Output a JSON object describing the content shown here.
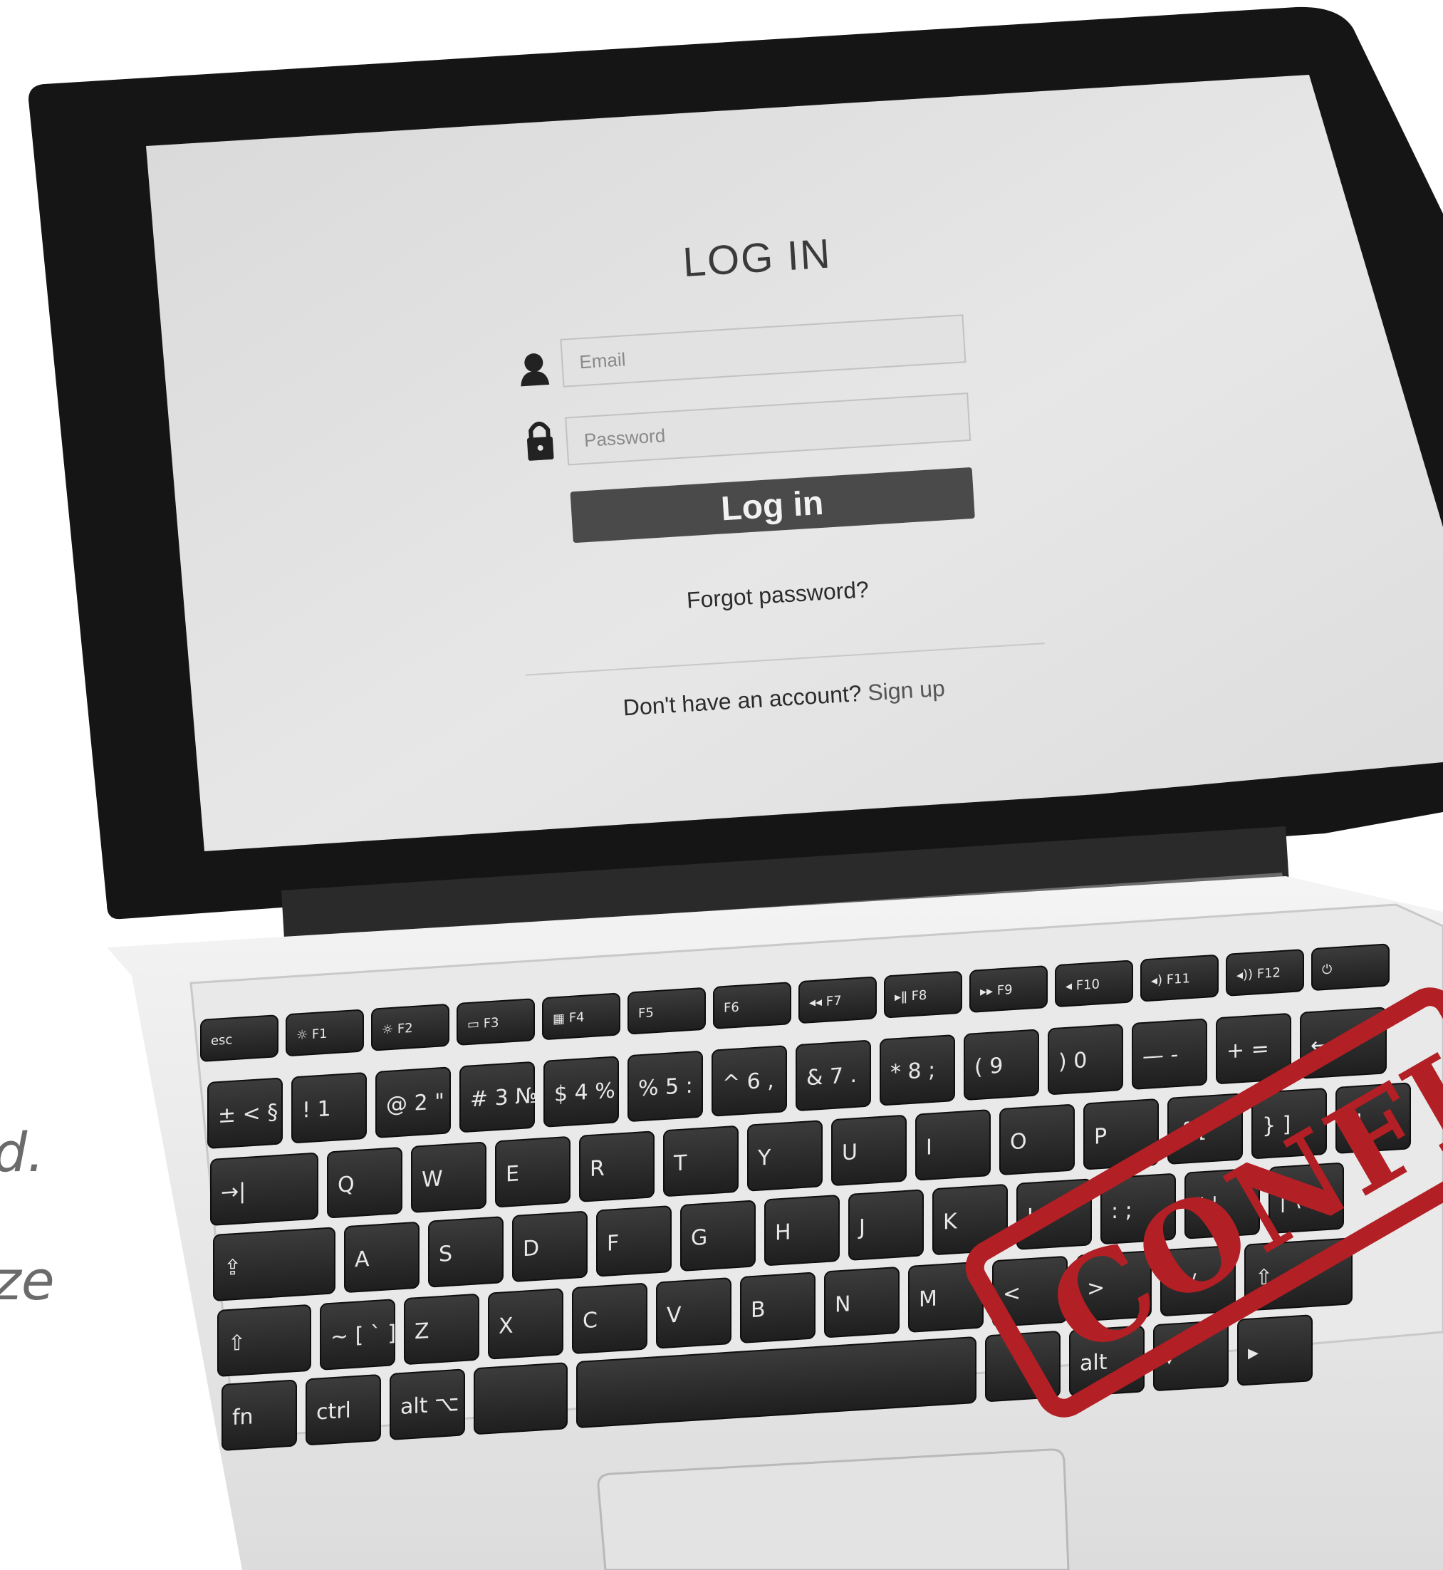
{
  "login": {
    "title": "LOG IN",
    "email_placeholder": "Email",
    "password_placeholder": "Password",
    "login_button": "Log in",
    "forgot": "Forgot password?",
    "no_account": "Don't have an account?",
    "signup": "Sign up",
    "user_icon": "user-icon",
    "lock_icon": "lock-icon"
  },
  "keyboard": {
    "fn_row": [
      "esc",
      "☼ F1",
      "☼ F2",
      "▭ F3",
      "▦ F4",
      "F5",
      "F6",
      "◂◂ F7",
      "▸ǁ F8",
      "▸▸ F9",
      "◂ F10",
      "◂) F11",
      "◂)) F12",
      "⏻"
    ],
    "num_row": [
      "± < § >",
      "! 1",
      "@ 2 \"",
      "# 3 №",
      "$ 4 %",
      "% 5 :",
      "^ 6 ,",
      "& 7 .",
      "* 8 ;",
      "( 9",
      ") 0",
      "— -",
      "+ =",
      "←"
    ],
    "top_row": [
      "→|",
      "Q",
      "W",
      "E",
      "R",
      "T",
      "Y",
      "U",
      "I",
      "O",
      "P",
      "{ [",
      "} ]",
      "↵"
    ],
    "home_row": [
      "⇪",
      "A",
      "S",
      "D",
      "F",
      "G",
      "H",
      "J",
      "K",
      "L",
      ": ;",
      "\" '",
      "| \\"
    ],
    "bottom_row": [
      "⇧",
      "~ [ ` ]",
      "Z",
      "X",
      "C",
      "V",
      "B",
      "N",
      "M",
      "<",
      ">",
      "? /",
      "⇧"
    ],
    "space_row": [
      "fn",
      "ctrl",
      "alt ⌥",
      "",
      "",
      "",
      "alt",
      "▾",
      "▸"
    ]
  },
  "stamp": {
    "text": "CONFI",
    "color": "#b21f24"
  },
  "side_text": {
    "line1": "d.",
    "line2": "ze"
  }
}
